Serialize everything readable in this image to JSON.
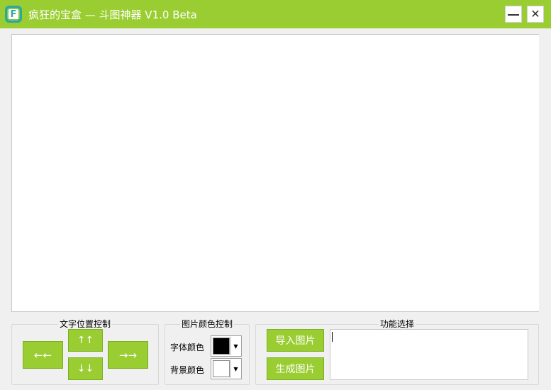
{
  "window": {
    "title": "疯狂的宝盒 — 斗图神器  V1.0 Beta",
    "logo_letter": "F",
    "minimize_icon": "minimize-icon",
    "close_icon": "close-icon",
    "close_glyph": "✕",
    "accent_color": "#9acd32"
  },
  "text_position": {
    "title": "文字位置控制",
    "left_label": "←←",
    "up_label": "↑↑",
    "down_label": "↓↓",
    "right_label": "→→"
  },
  "color_control": {
    "title": "图片颜色控制",
    "font_color_label": "字体颜色",
    "font_color": "#000000",
    "bg_color_label": "背景颜色",
    "bg_color": "#ffffff",
    "dropdown_glyph": "▼"
  },
  "functions": {
    "title": "功能选择",
    "import_label": "导入图片",
    "generate_label": "生成图片",
    "text_value": ""
  }
}
